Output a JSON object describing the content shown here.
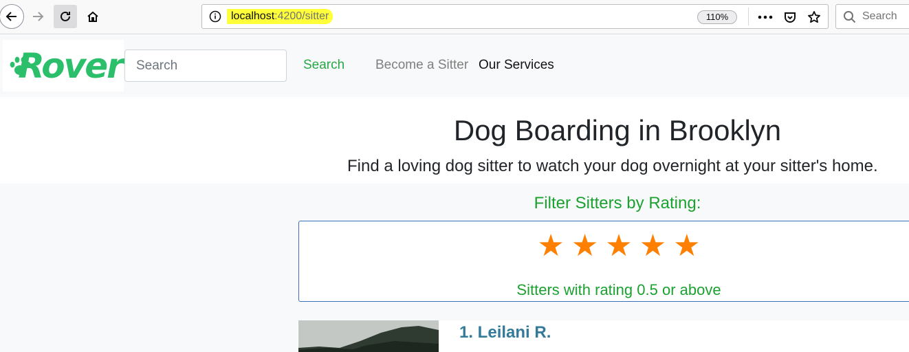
{
  "browser": {
    "url_host": "localhost",
    "url_path": ":4200/sitter",
    "zoom": "110%",
    "search_placeholder": "Search"
  },
  "navbar": {
    "logo_text": "Rover",
    "search_placeholder": "Search",
    "search_button": "Search",
    "links": [
      "Become a Sitter",
      "Our Services"
    ]
  },
  "hero": {
    "title": "Dog Boarding in Brooklyn",
    "subtitle": "Find a loving dog sitter to watch your dog overnight at your sitter's home."
  },
  "filter": {
    "title": "Filter Sitters by Rating:",
    "stars": [
      "★",
      "★",
      "★",
      "★",
      "★"
    ],
    "caption": "Sitters with rating 0.5 or above",
    "star_color": "#ff7f00",
    "accent_color": "#1aa130"
  },
  "sitters": [
    {
      "name": "1. Leilani R."
    }
  ]
}
